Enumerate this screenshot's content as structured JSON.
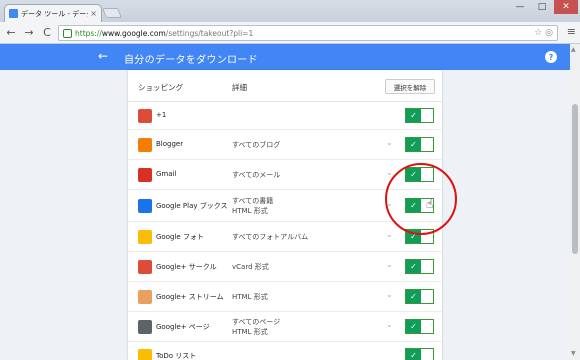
{
  "browser": {
    "tab_title": "データ ツール - データのダウ",
    "tab_close": "×",
    "url_scheme": "https://",
    "url_host": "www.google.com",
    "url_path": "/settings/takeout?pli=1",
    "win_min": "—",
    "win_max": "□",
    "win_close": "✕",
    "back": "←",
    "forward": "→",
    "reload": "C",
    "home": "⌂",
    "omni_icons": "☆ ◎",
    "menu": "≡"
  },
  "appbar": {
    "back": "←",
    "title": "自分のデータをダウンロード",
    "help": "?",
    "color": "#4285f4"
  },
  "table": {
    "col_product": "ショッピング",
    "col_detail": "詳細",
    "deselect_label": "選択を解除",
    "rows": [
      {
        "name": "+1",
        "detail": "",
        "icon": "gplus-one-icon",
        "color": "#dd4b39",
        "checked": true
      },
      {
        "name": "Blogger",
        "detail": "すべてのブログ",
        "icon": "blogger-icon",
        "color": "#f57d00",
        "checked": true
      },
      {
        "name": "Gmail",
        "detail": "すべてのメール",
        "icon": "gmail-icon",
        "color": "#d93025",
        "checked": true
      },
      {
        "name": "Google Play ブックス",
        "detail": "すべての書籍\nHTML 形式",
        "icon": "play-books-icon",
        "color": "#1a73e8",
        "checked": true
      },
      {
        "name": "Google フォト",
        "detail": "すべてのフォトアルバム",
        "icon": "photos-icon",
        "color": "#fbbc05",
        "checked": true
      },
      {
        "name": "Google+ サークル",
        "detail": "vCard 形式",
        "icon": "gplus-circles-icon",
        "color": "#dd4b39",
        "checked": true
      },
      {
        "name": "Google+ ストリーム",
        "detail": "HTML 形式",
        "icon": "gplus-stream-icon",
        "color": "#e8a060",
        "checked": true
      },
      {
        "name": "Google+ ページ",
        "detail": "すべてのページ\nHTML 形式",
        "icon": "gplus-pages-icon",
        "color": "#5f6368",
        "checked": true
      },
      {
        "name": "ToDo リスト",
        "detail": "",
        "icon": "tasks-icon",
        "color": "#fbbc05",
        "checked": true
      }
    ],
    "chevron": "⌄",
    "check": "✓",
    "toggle_color": "#0f9d58"
  },
  "cursor": "☝"
}
